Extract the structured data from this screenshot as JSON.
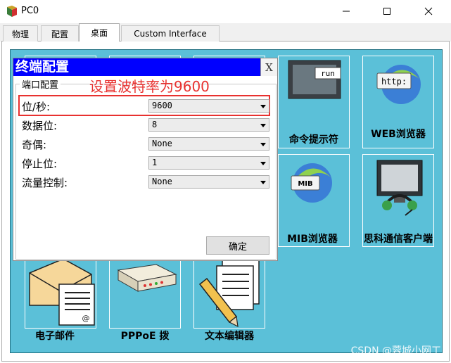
{
  "window": {
    "title": "PC0",
    "icon": "packet-tracer-pc-icon",
    "controls": [
      "minimize-icon",
      "maximize-icon",
      "close-icon"
    ]
  },
  "tabs": [
    {
      "label": "物理"
    },
    {
      "label": "配置"
    },
    {
      "label": "桌面",
      "active": true
    },
    {
      "label": "Custom Interface"
    }
  ],
  "desktop": {
    "background": "#5bc0d8",
    "tiles": {
      "command_prompt": {
        "label": "命令提示符",
        "icon_text": "run"
      },
      "web_browser": {
        "label": "WEB浏览器",
        "icon_text": "http:"
      },
      "mib_browser": {
        "label": "MIB浏览器",
        "icon_text": "MIB"
      },
      "cisco_ip_communicator": {
        "label": "思科通信客户端"
      },
      "email": {
        "label": "电子邮件"
      },
      "pppoe": {
        "label": "PPPoE 拨"
      },
      "text_editor": {
        "label": "文本编辑器"
      }
    }
  },
  "dialog": {
    "title": "终端配置",
    "close_label": "X",
    "group_title": "端口配置",
    "annotation": "设置波特率为9600",
    "fields": [
      {
        "label": "位/秒:",
        "value": "9600"
      },
      {
        "label": "数据位:",
        "value": "8"
      },
      {
        "label": "奇偶:",
        "value": "None"
      },
      {
        "label": "停止位:",
        "value": "1"
      },
      {
        "label": "流量控制:",
        "value": "None"
      }
    ],
    "ok_label": "确定"
  },
  "watermark": "CSDN @蓉城小网工",
  "colors": {
    "dialog_title_bg": "#0000ff",
    "annotation": "#e8312f",
    "desktop_bg": "#5bc0d8"
  }
}
